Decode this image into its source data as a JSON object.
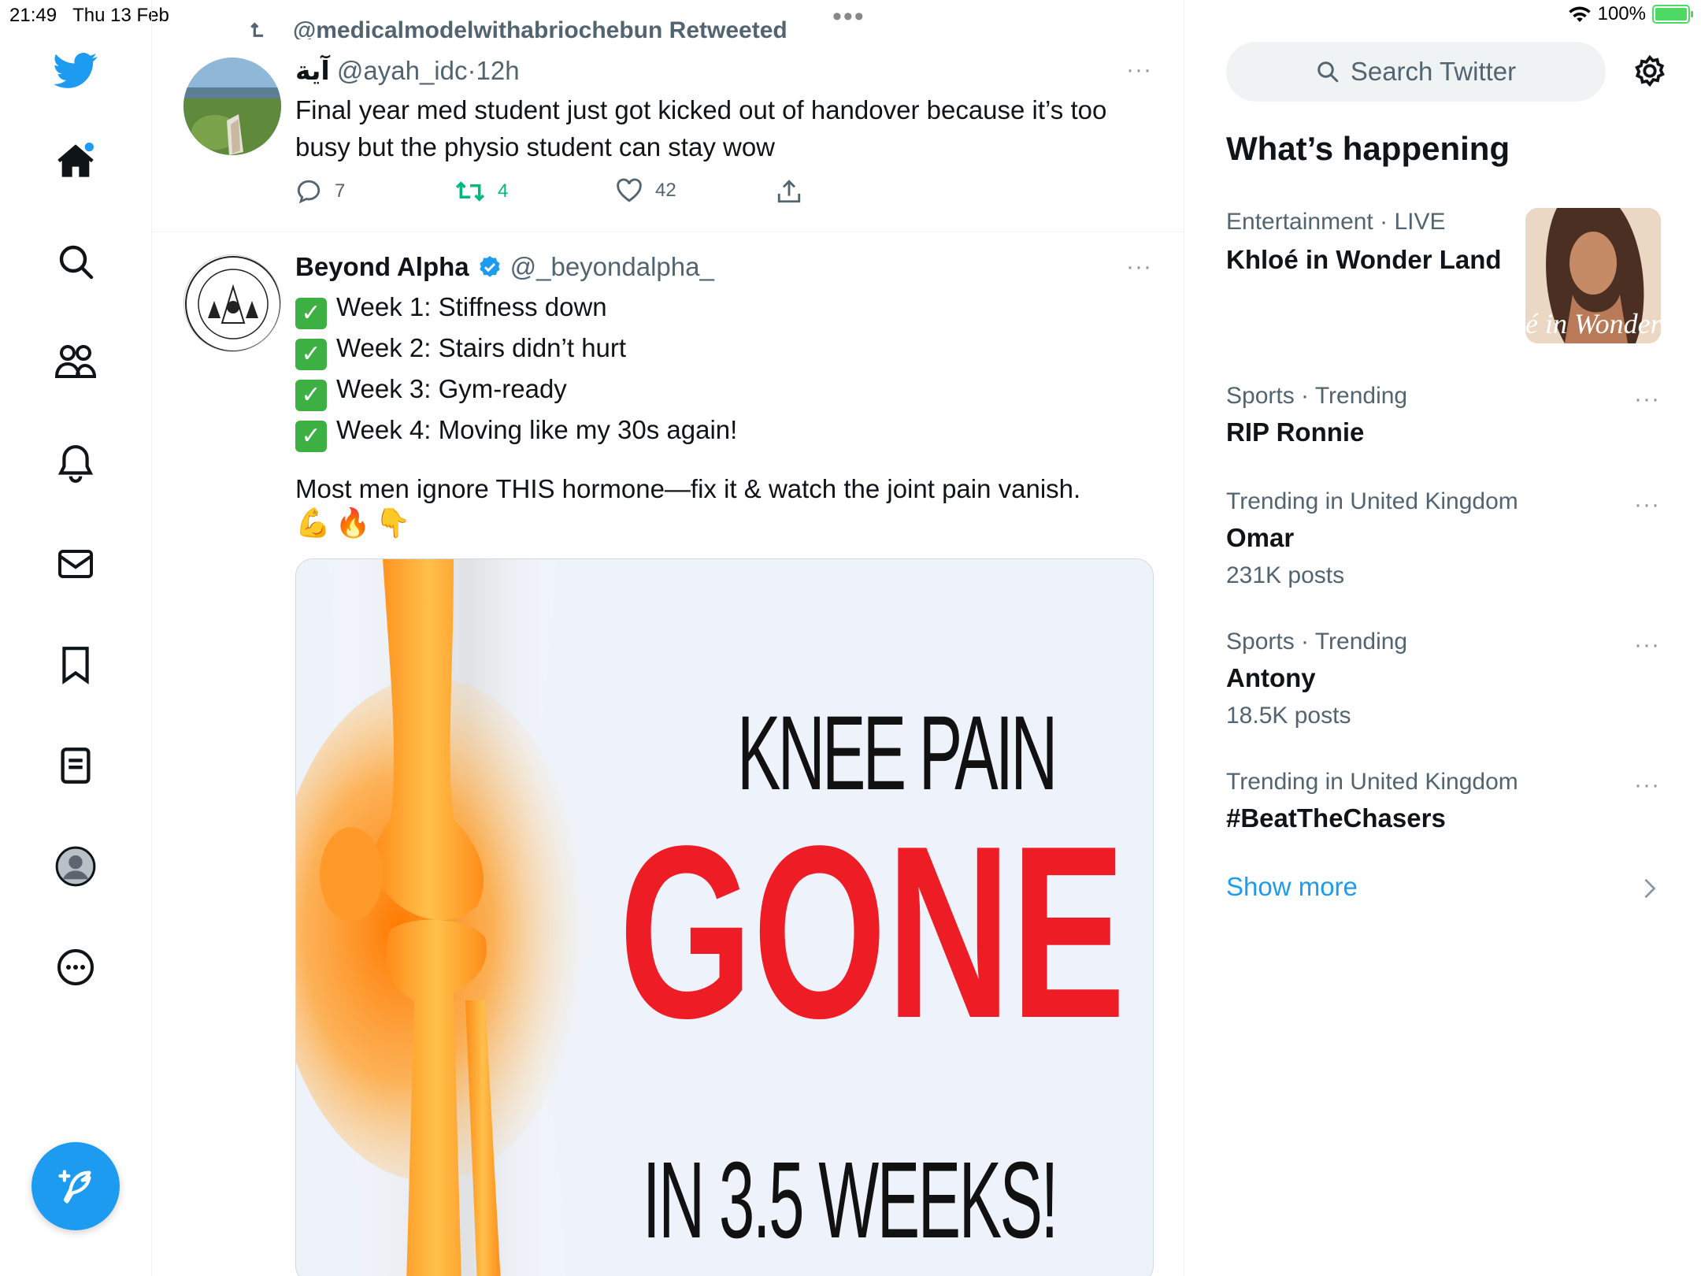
{
  "status_bar": {
    "time": "21:49",
    "date": "Thu 13 Feb",
    "battery": "100%",
    "battery_level": 1.0,
    "multitask_dots": "•••"
  },
  "sidebar": {
    "items": [
      {
        "name": "twitter-logo-icon"
      },
      {
        "name": "home-icon"
      },
      {
        "name": "search-icon"
      },
      {
        "name": "communities-icon"
      },
      {
        "name": "notifications-icon"
      },
      {
        "name": "messages-icon"
      },
      {
        "name": "bookmarks-icon"
      },
      {
        "name": "lists-icon"
      },
      {
        "name": "profile-icon"
      },
      {
        "name": "more-icon"
      }
    ],
    "compose_icon": "compose-icon"
  },
  "timeline": {
    "retweet_context": "@medicalmodelwithabriochebun Retweeted",
    "tweet1": {
      "name": "آية",
      "handle": "@ayah_idc",
      "separator": "·",
      "time": "12h",
      "text": "Final year med student just got kicked out of handover because it’s too busy but the physio student can stay wow",
      "replies": "7",
      "retweets": "4",
      "likes": "42",
      "more": "···"
    },
    "tweet2": {
      "name": "Beyond Alpha",
      "handle": "@_beyondalpha_",
      "more": "···",
      "lines": [
        "Week 1: Stiffness down",
        "Week 2: Stairs didn’t hurt",
        "Week 3: Gym-ready",
        "Week 4: Moving like my 30s again!"
      ],
      "body": "Most men ignore THIS hormone—fix it & watch the joint pain vanish.",
      "emojis": "💪🔥👇",
      "media": {
        "line1": "KNEE PAIN",
        "line2": "GONE",
        "line3": "IN 3.5 WEEKS!"
      }
    }
  },
  "right_column": {
    "search_placeholder": "Search Twitter",
    "section_title": "What’s happening",
    "featured": {
      "meta_category": "Entertainment",
      "meta_status": "LIVE",
      "separator": "·",
      "title": "Khloé in Wonder Land",
      "thumb_text": "é in Wonder l"
    },
    "trends": [
      {
        "meta": "Sports · Trending",
        "title": "RIP Ronnie",
        "count": ""
      },
      {
        "meta": "Trending in United Kingdom",
        "title": "Omar",
        "count": "231K posts"
      },
      {
        "meta": "Sports · Trending",
        "title": "Antony",
        "count": "18.5K posts"
      },
      {
        "meta": "Trending in United Kingdom",
        "title": "#BeatTheChasers",
        "count": ""
      }
    ],
    "show_more": "Show more",
    "colors": {
      "accent": "#1d9bf0",
      "retweet": "#00ba7c",
      "text": "#0f1419",
      "secondary": "#536471"
    }
  }
}
